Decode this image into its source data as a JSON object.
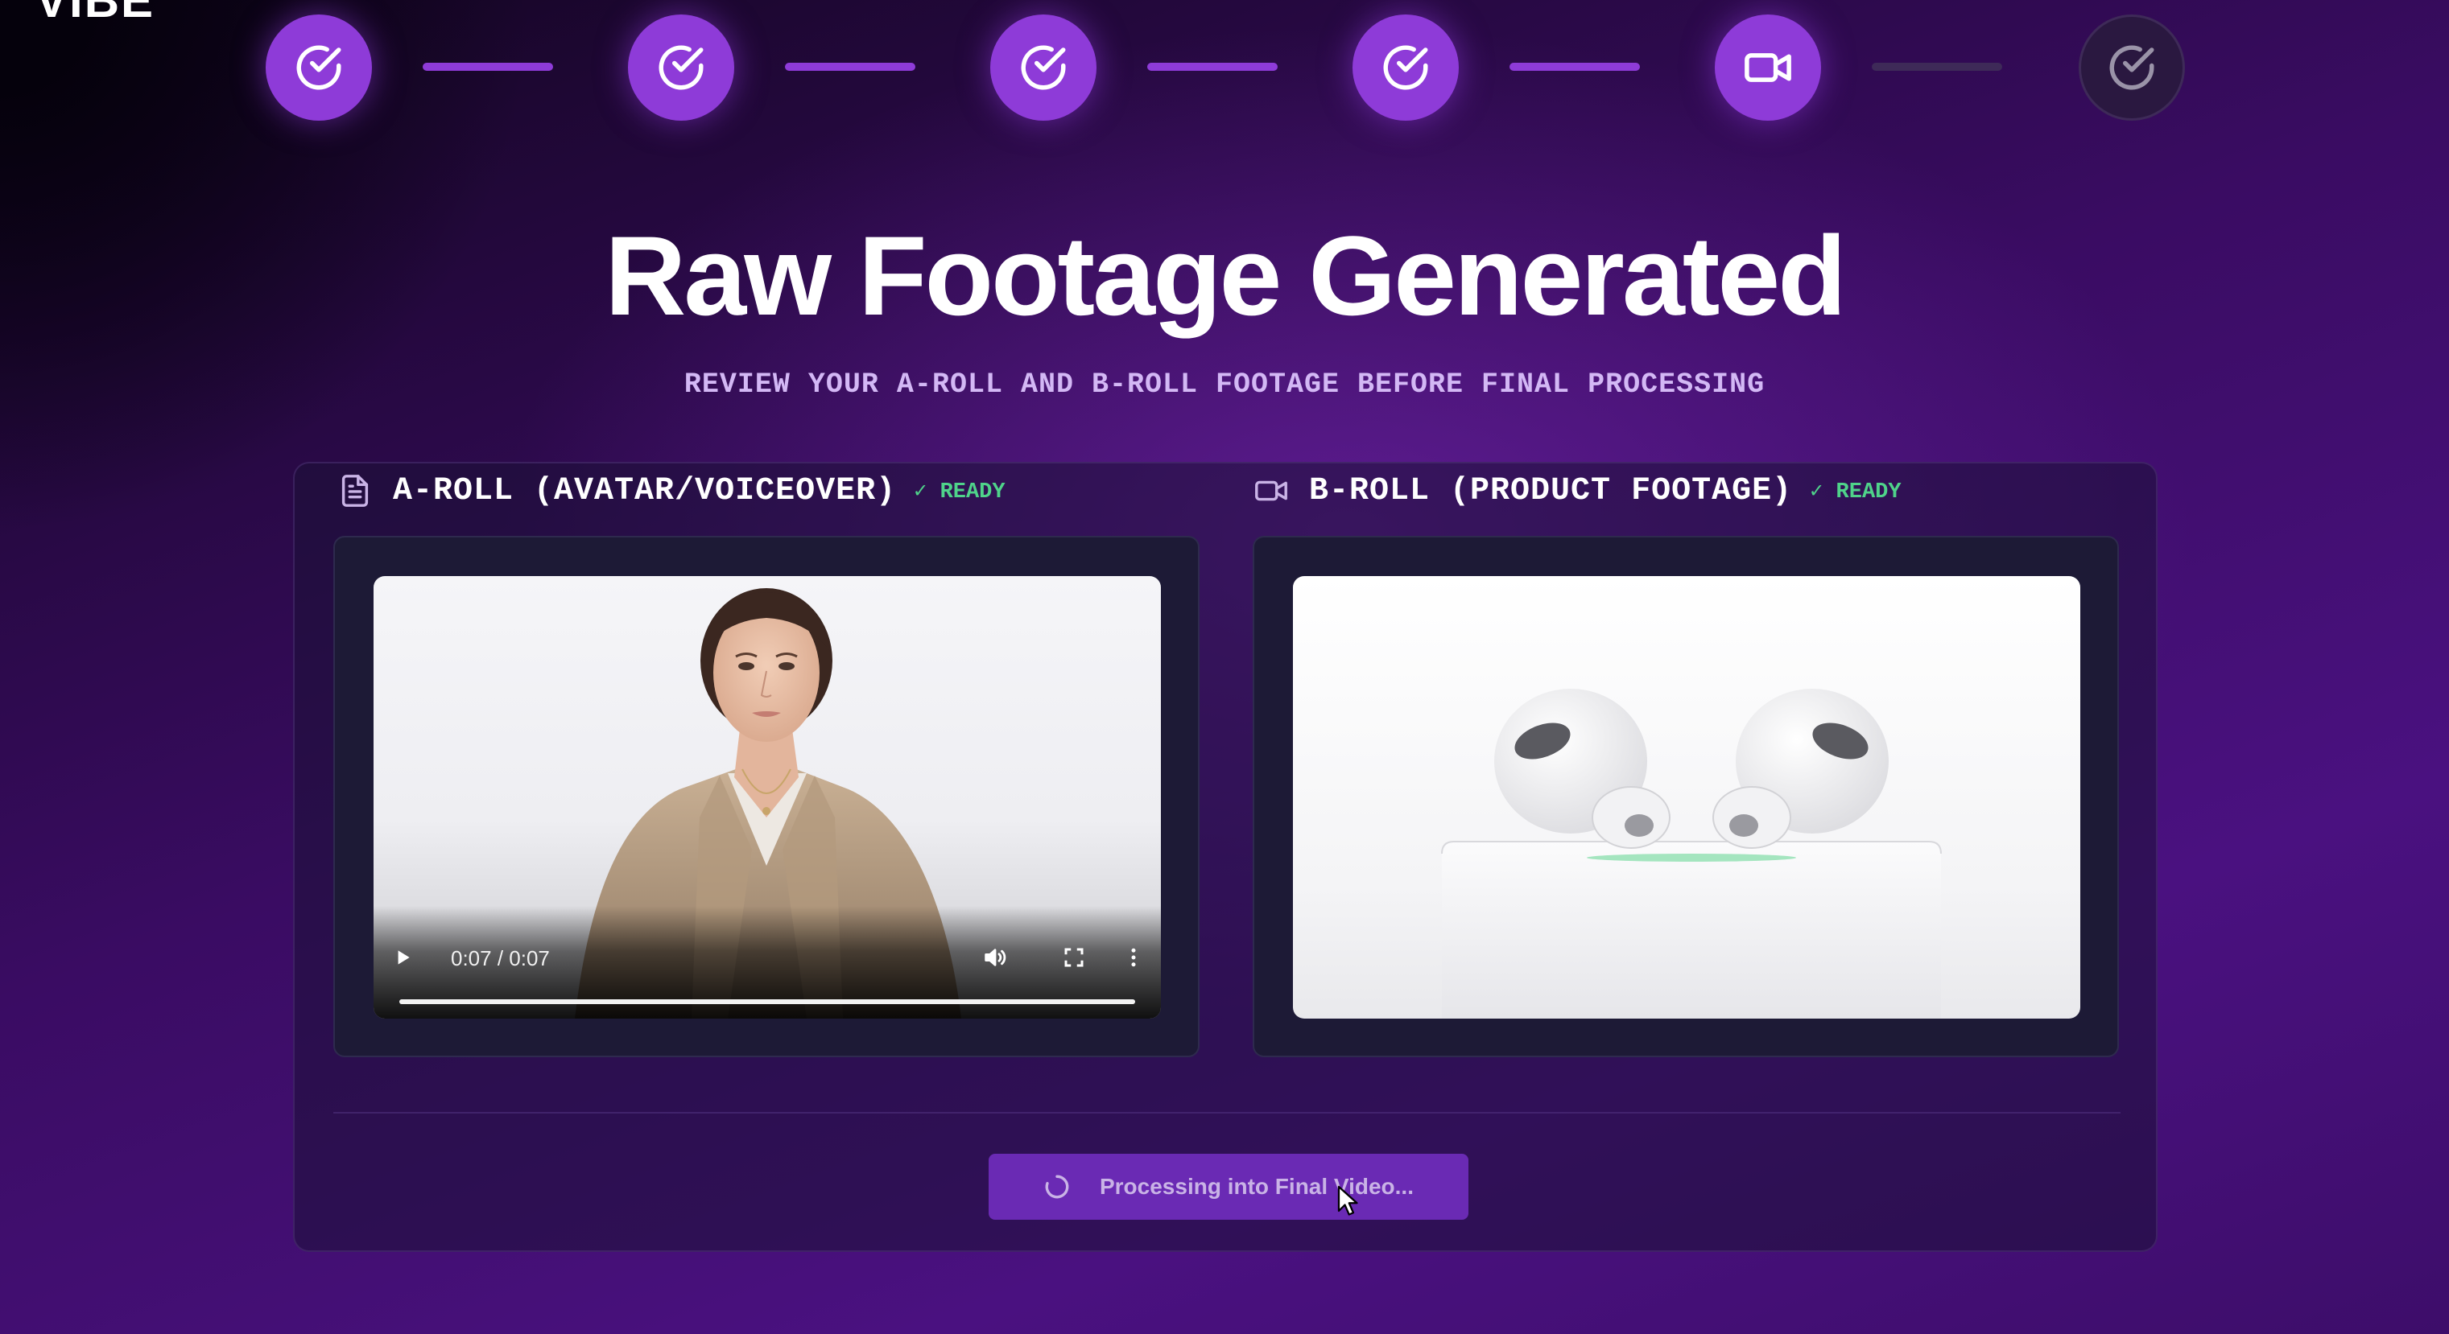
{
  "app": {
    "logo": "VIBE"
  },
  "stepper": {
    "steps": [
      {
        "state": "done",
        "icon": "check-circle-icon"
      },
      {
        "state": "done",
        "icon": "check-circle-icon"
      },
      {
        "state": "done",
        "icon": "check-circle-icon"
      },
      {
        "state": "done",
        "icon": "check-circle-icon"
      },
      {
        "state": "active",
        "icon": "video-camera-icon"
      },
      {
        "state": "pending",
        "icon": "check-circle-icon"
      }
    ]
  },
  "page": {
    "title": "Raw Footage Generated",
    "subtitle": "REVIEW YOUR A-ROLL AND B-ROLL FOOTAGE BEFORE FINAL PROCESSING"
  },
  "aroll": {
    "icon": "document-icon",
    "title": "A-ROLL (AVATAR/VOICEOVER)",
    "status": "✓ READY",
    "video": {
      "time": "0:07 / 0:07",
      "progress_percent": 100
    }
  },
  "broll": {
    "icon": "video-camera-icon",
    "title": "B-ROLL (PRODUCT FOOTAGE)",
    "status": "✓ READY"
  },
  "actions": {
    "process_label": "Processing into Final Video..."
  },
  "colors": {
    "accent": "#8e3bd8",
    "ready": "#4fd38a",
    "button": "#6a2ab4"
  }
}
